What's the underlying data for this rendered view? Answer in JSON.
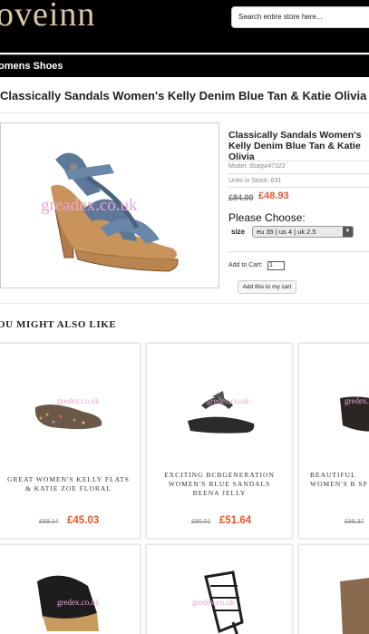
{
  "header": {
    "logo": "oveinn",
    "search_placeholder": "Search entire store here..."
  },
  "nav": {
    "category": "omens Shoes"
  },
  "product": {
    "title": "Classically Sandals Women's Kelly Denim Blue Tan & Katie Olivia",
    "info_title": "Classically Sandals Women's Kelly Denim Blue Tan & Katie Olivia",
    "model": "Model: dsaqw47322",
    "stock": "Units in Stock: 631",
    "old_price": "£84.00",
    "new_price": "£48.93",
    "choose_label": "Please Choose:",
    "size_label": "size",
    "size_value": "eu 35 | us 4 | uk 2.5",
    "add_to_cart_label": "Add to Cart:",
    "quantity": "1",
    "add_button": "Add this to my cart",
    "watermark": "greadex.co.uk"
  },
  "also_like": {
    "title": "OU MIGHT ALSO LIKE",
    "watermark": "gredex.co.uk",
    "items": [
      {
        "name": "GREAT WOMEN'S KELLY FLATS & KATIE ZOE FLORAL",
        "old_price": "£69.14",
        "new_price": "£45.03"
      },
      {
        "name": "EXCITING BCBGENERATION WOMEN'S BLUE SANDALS BEENA JELLY",
        "old_price": "£90.01",
        "new_price": "£51.64"
      },
      {
        "name": "BEAUTIFUL WOMEN'S B SP",
        "old_price": "£86.37",
        "new_price": ""
      }
    ]
  },
  "colors": {
    "accent_price": "#e2582e",
    "header_bg": "#000000",
    "logo_gold": "#d9c7a6"
  }
}
